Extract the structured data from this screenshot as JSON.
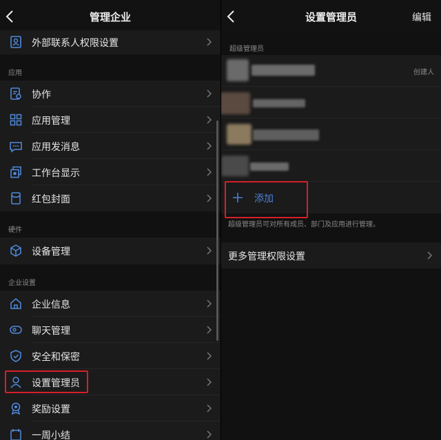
{
  "left": {
    "title": "管理企业",
    "top_item": "外部联系人权限设置",
    "sections": [
      {
        "label": "应用",
        "items": [
          "协作",
          "应用管理",
          "应用发消息",
          "工作台显示",
          "红包封面"
        ]
      },
      {
        "label": "硬件",
        "items": [
          "设备管理"
        ]
      },
      {
        "label": "企业设置",
        "items": [
          "企业信息",
          "聊天管理",
          "安全和保密",
          "设置管理员",
          "奖励设置",
          "一周小结"
        ]
      }
    ],
    "icons": {
      "top": "contact-card-icon",
      "apps": [
        "collaboration-icon",
        "app-grid-icon",
        "message-dots-icon",
        "workbench-icon",
        "red-envelope-icon"
      ],
      "hardware": [
        "device-cube-icon"
      ],
      "enterprise": [
        "home-icon",
        "chat-bubble-icon",
        "shield-icon",
        "user-admin-icon",
        "award-icon",
        "summary-icon"
      ]
    }
  },
  "right": {
    "title": "设置管理员",
    "edit": "编辑",
    "super_label": "超级管理员",
    "creator_tag": "创建人",
    "add_label": "添加",
    "note": "超级管理员可对所有成员、部门及应用进行管理。",
    "more_settings": "更多管理权限设置"
  },
  "colors": {
    "highlight": "#d7202a",
    "accent_blue": "#4c7fd6",
    "icon_blue": "#4f8be0"
  }
}
